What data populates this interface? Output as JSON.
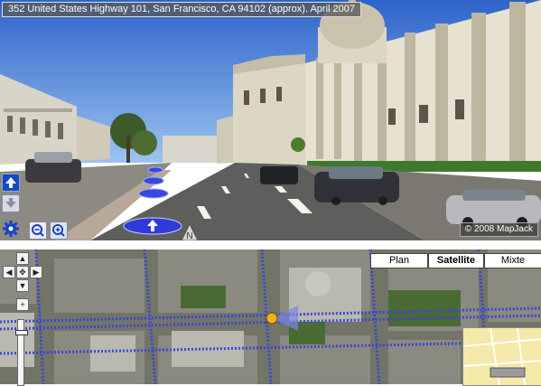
{
  "street_view": {
    "address_bar": "352 United States Highway 101, San Francisco, CA 94102 (approx). April 2007",
    "copyright": "© 2008 MapJack",
    "controls": {
      "move_forward": "up-arrow-icon",
      "move_back": "down-arrow-icon",
      "settings": "gear-icon",
      "zoom_out": "zoom-out-icon",
      "zoom_in": "zoom-in-icon",
      "north": "N"
    }
  },
  "map": {
    "type_buttons": [
      "Plan",
      "Satellite",
      "Mixte"
    ],
    "selected_type": "Satellite",
    "pan_controls": [
      "up",
      "left",
      "center",
      "right",
      "down"
    ],
    "colors": {
      "accent": "#1448c8",
      "street_overlay": "#3a46d8",
      "position_marker": "#f2b21a"
    }
  }
}
